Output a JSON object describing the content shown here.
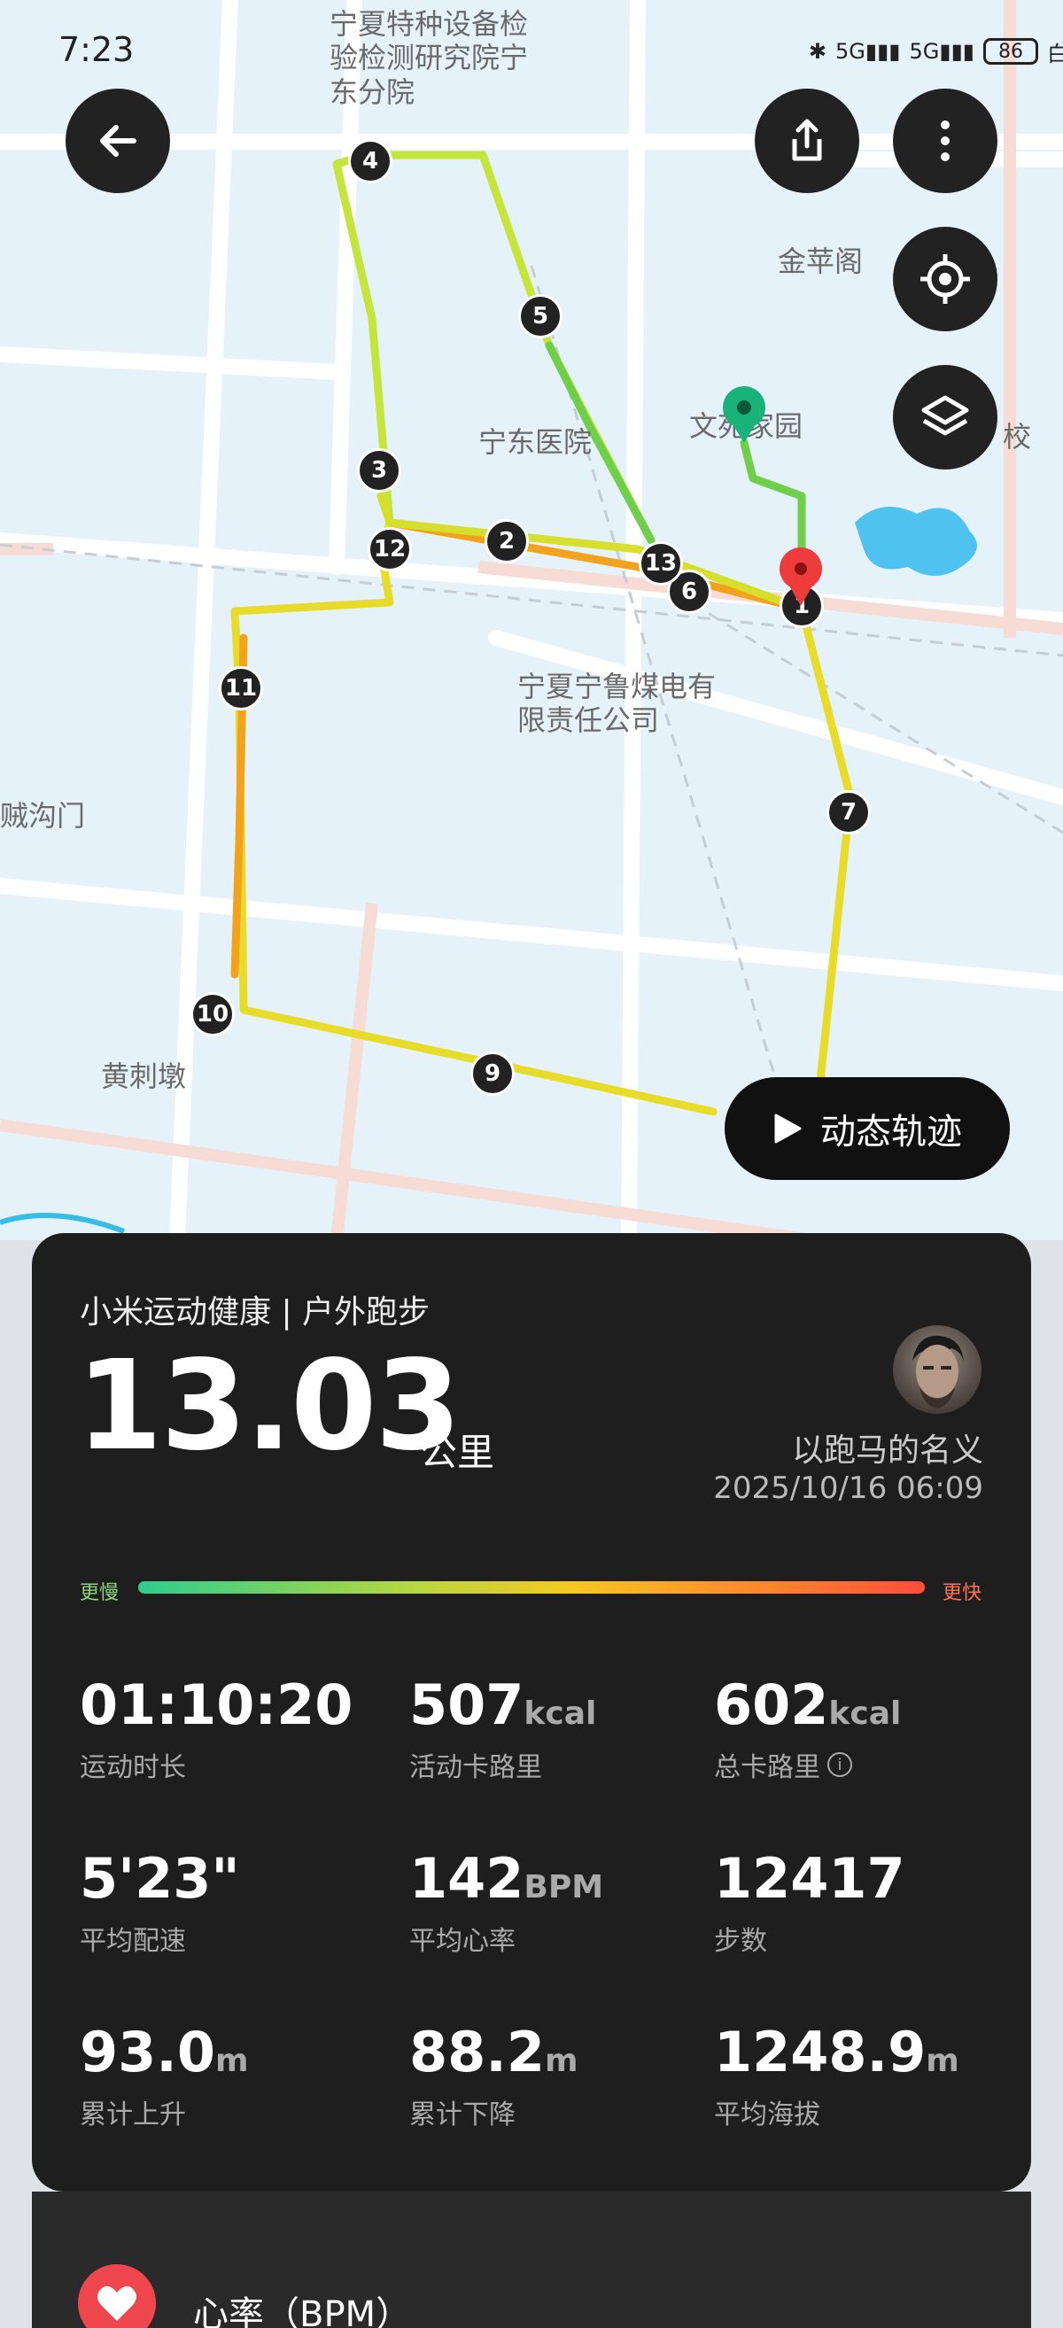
{
  "status_bar": {
    "time": "7:23",
    "battery": "86"
  },
  "map": {
    "labels": [
      "宁夏特种设备检验检测研究院宁东分院",
      "金苹阁",
      "宁东医院",
      "文苑家园",
      "宁夏宁鲁煤电有限责任公司",
      "贼沟门",
      "黄刺墩",
      "校"
    ],
    "markers": [
      "1",
      "2",
      "3",
      "4",
      "5",
      "6",
      "7",
      "9",
      "10",
      "11",
      "12",
      "13"
    ],
    "icons": {
      "back": "back-arrow-icon",
      "share": "share-icon",
      "more": "more-vertical-icon",
      "locate": "locate-icon",
      "layers": "layers-icon",
      "start": "start-pin-icon",
      "end": "end-pin-icon"
    }
  },
  "playback_button": {
    "label": "动态轨迹"
  },
  "summary": {
    "source": "小米运动健康 | 户外跑步",
    "distance": "13.03",
    "distance_unit": "公里",
    "user_name": "以跑马的名义",
    "date": "2025/10/16 06:09",
    "pace_bar": {
      "slow_label": "更慢",
      "fast_label": "更快"
    }
  },
  "stats": [
    {
      "value": "01:10:20",
      "unit": "",
      "label": "运动时长"
    },
    {
      "value": "507",
      "unit": "kcal",
      "label": "活动卡路里"
    },
    {
      "value": "602",
      "unit": "kcal",
      "label": "总卡路里"
    },
    {
      "value": "5'23\"",
      "unit": "",
      "label": "平均配速"
    },
    {
      "value": "142",
      "unit": "BPM",
      "label": "平均心率"
    },
    {
      "value": "12417",
      "unit": "",
      "label": "步数"
    },
    {
      "value": "93.0",
      "unit": "m",
      "label": "累计上升"
    },
    {
      "value": "88.2",
      "unit": "m",
      "label": "累计下降"
    },
    {
      "value": "1248.9",
      "unit": "m",
      "label": "平均海拔"
    }
  ],
  "heart_rate_section": {
    "title": "心率（BPM）"
  },
  "colors": {
    "accent_red": "#f0474f",
    "card_bg": "#1e1e1f",
    "route_yellow": "#e8dc2a",
    "route_orange": "#f3a21c",
    "route_green": "#6fcf4a"
  }
}
